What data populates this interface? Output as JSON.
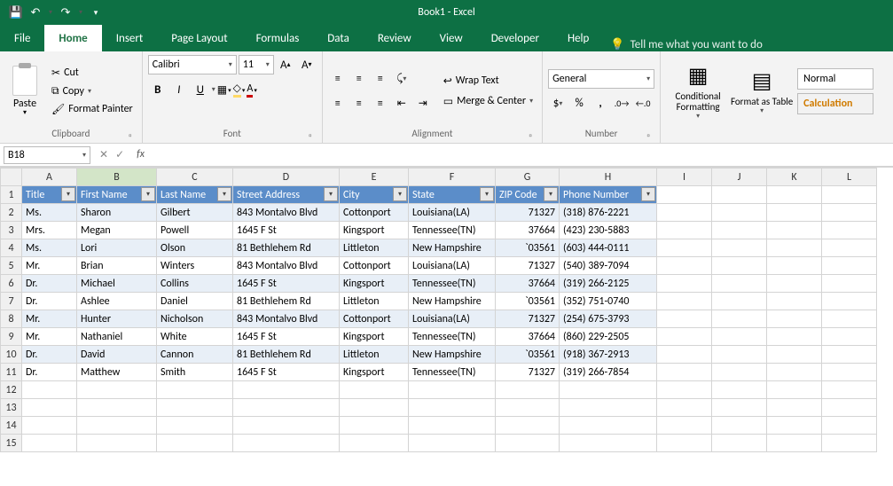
{
  "title": "Book1 - Excel",
  "tabs": [
    "File",
    "Home",
    "Insert",
    "Page Layout",
    "Formulas",
    "Data",
    "Review",
    "View",
    "Developer",
    "Help"
  ],
  "active_tab": 1,
  "tell_me": "Tell me what you want to do",
  "clipboard": {
    "paste": "Paste",
    "cut": "Cut",
    "copy": "Copy",
    "fmt": "Format Painter",
    "label": "Clipboard"
  },
  "font": {
    "name": "Calibri",
    "size": "11",
    "label": "Font"
  },
  "alignment": {
    "wrap": "Wrap Text",
    "merge": "Merge & Center",
    "label": "Alignment"
  },
  "number": {
    "format": "General",
    "label": "Number"
  },
  "styles": {
    "cond": "Conditional Formatting",
    "table": "Format as Table",
    "normal": "Normal",
    "calc": "Calculation"
  },
  "namebox": "B18",
  "columns": [
    "A",
    "B",
    "C",
    "D",
    "E",
    "F",
    "G",
    "H",
    "I",
    "J",
    "K",
    "L"
  ],
  "headers": [
    "Title",
    "First Name",
    "Last Name",
    "Street Address",
    "City",
    "State",
    "ZIP Code",
    "Phone Number"
  ],
  "rows": [
    [
      "Ms.",
      "Sharon",
      "Gilbert",
      "843 Montalvo Blvd",
      "Cottonport",
      "Louisiana(LA)",
      "71327",
      "(318) 876-2221"
    ],
    [
      "Mrs.",
      "Megan",
      "Powell",
      "1645 F St",
      "Kingsport",
      "Tennessee(TN)",
      "37664",
      "(423) 230-5883"
    ],
    [
      "Ms.",
      "Lori",
      "Olson",
      "81 Bethlehem Rd",
      "Littleton",
      "New Hampshire",
      "`03561",
      "(603) 444-0111"
    ],
    [
      "Mr.",
      "Brian",
      "Winters",
      "843 Montalvo Blvd",
      "Cottonport",
      "Louisiana(LA)",
      "71327",
      "(540) 389-7094"
    ],
    [
      "Dr.",
      "Michael",
      "Collins",
      "1645 F St",
      "Kingsport",
      "Tennessee(TN)",
      "37664",
      "(319) 266-2125"
    ],
    [
      "Dr.",
      "Ashlee",
      "Daniel",
      "81 Bethlehem Rd",
      "Littleton",
      "New Hampshire",
      "`03561",
      "(352) 751-0740"
    ],
    [
      "Mr.",
      "Hunter",
      "Nicholson",
      "843 Montalvo Blvd",
      "Cottonport",
      "Louisiana(LA)",
      "71327",
      "(254) 675-3793"
    ],
    [
      "Mr.",
      "Nathaniel",
      "White",
      "1645 F St",
      "Kingsport",
      "Tennessee(TN)",
      "37664",
      "(860) 229-2505"
    ],
    [
      "Dr.",
      "David",
      "Cannon",
      "81 Bethlehem Rd",
      "Littleton",
      "New Hampshire",
      "`03561",
      "(918) 367-2913"
    ],
    [
      "Dr.",
      "Matthew",
      "Smith",
      "1645 F St",
      "Kingsport",
      "Tennessee(TN)",
      "71327",
      "(319) 266-7854"
    ]
  ],
  "empty_row_count": 4,
  "selected_col_letter": "B"
}
